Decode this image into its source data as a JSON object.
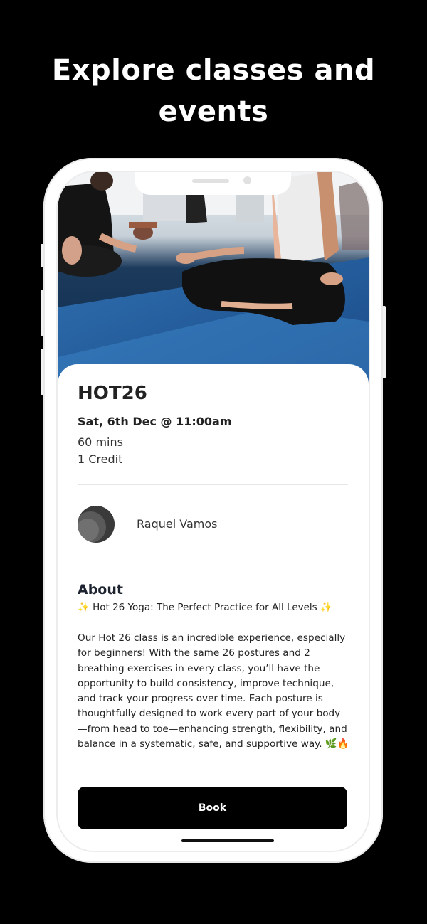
{
  "headline": "Explore classes and events",
  "class": {
    "title": "HOT26",
    "datetime": "Sat, 6th Dec @ 11:00am",
    "duration": "60 mins",
    "credits": "1 Credit"
  },
  "instructor": {
    "name": "Raquel Vamos"
  },
  "about": {
    "heading": "About",
    "subtitle": "✨ Hot 26 Yoga: The Perfect Practice for All Levels ✨",
    "body": "Our Hot 26 class is an incredible experience, especially for beginners! With the same 26 postures and 2 breathing exercises in every class, you’ll have the opportunity to build consistency, improve technique, and track your progress over time. Each posture is thoughtfully designed to work every part of your body —from head to toe—enhancing strength, flexibility, and balance in a systematic, safe, and supportive way. 🌿🔥"
  },
  "actions": {
    "book_label": "Book"
  },
  "colors": {
    "background": "#000000",
    "button": "#000000",
    "button_text": "#ffffff"
  }
}
